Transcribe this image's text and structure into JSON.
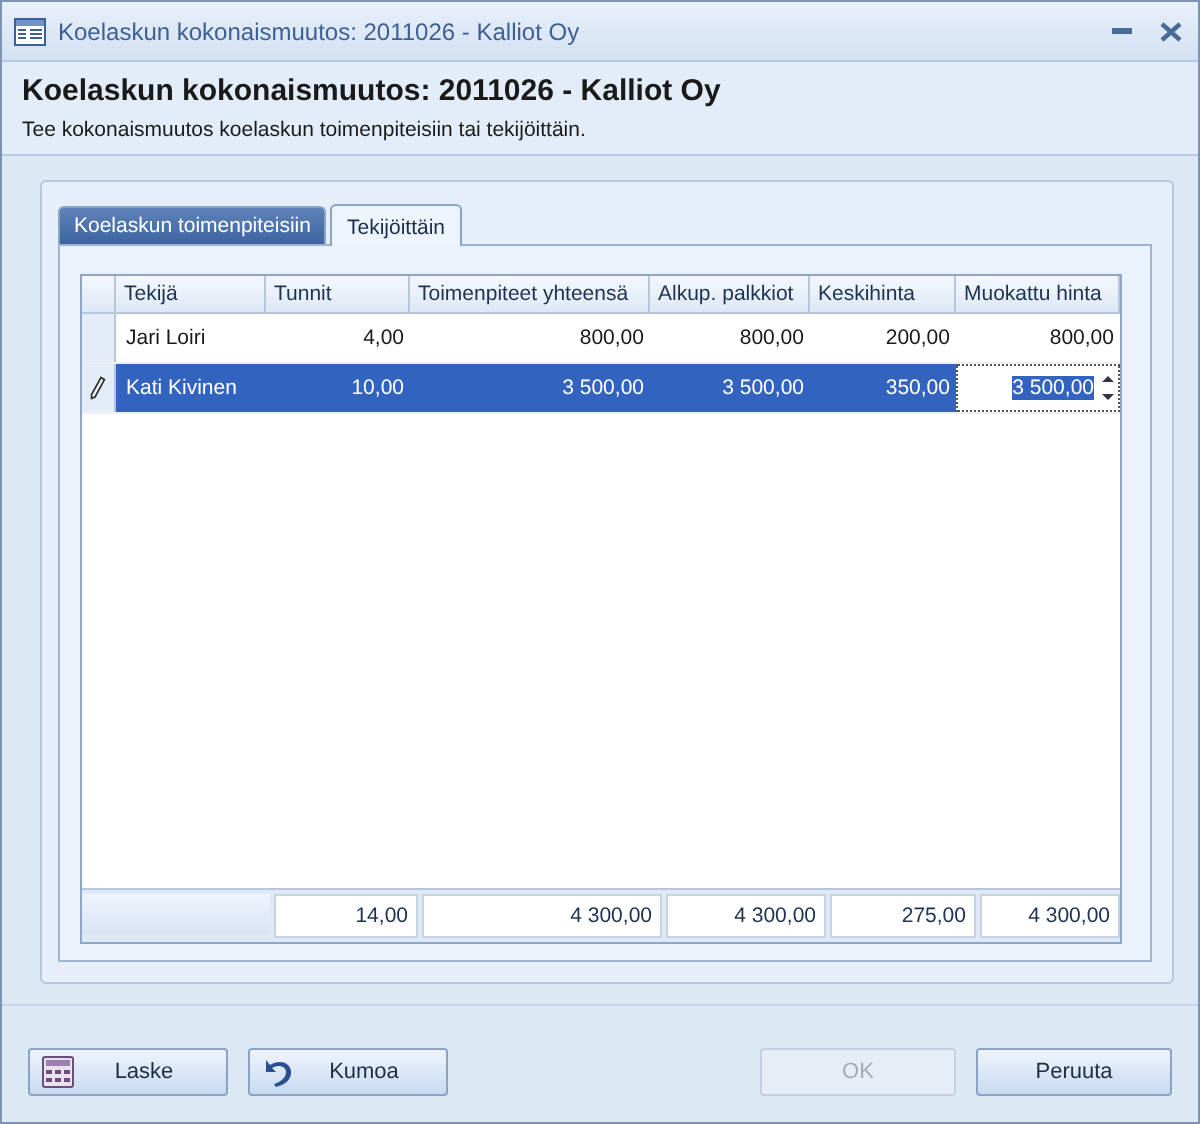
{
  "window": {
    "title": "Koelaskun kokonaismuutos: 2011026 - Kalliot Oy"
  },
  "header": {
    "title": "Koelaskun kokonaismuutos: 2011026 - Kalliot Oy",
    "description": "Tee kokonaismuutos koelaskun toimenpiteisiin tai tekijöittäin."
  },
  "tabs": [
    {
      "label": "Koelaskun toimenpiteisiin",
      "selected": false
    },
    {
      "label": "Tekijöittäin",
      "selected": true
    }
  ],
  "table": {
    "columns": [
      "Tekijä",
      "Tunnit",
      "Toimenpiteet yhteensä",
      "Alkup. palkkiot",
      "Keskihinta",
      "Muokattu hinta"
    ],
    "rows": [
      {
        "selected": false,
        "editing": false,
        "cells": [
          "Jari Loiri",
          "4,00",
          "800,00",
          "800,00",
          "200,00",
          "800,00"
        ]
      },
      {
        "selected": true,
        "editing": true,
        "cells": [
          "Kati Kivinen",
          "10,00",
          "3 500,00",
          "3 500,00",
          "350,00",
          "3 500,00"
        ]
      }
    ],
    "totals": [
      "14,00",
      "4 300,00",
      "4 300,00",
      "275,00",
      "4 300,00"
    ]
  },
  "buttons_left": [
    {
      "label": "Laske",
      "disabled": false
    },
    {
      "label": "Kumoa",
      "disabled": false
    }
  ],
  "buttons_right": [
    {
      "label": "OK",
      "disabled": true
    },
    {
      "label": "Peruuta",
      "disabled": false
    }
  ]
}
